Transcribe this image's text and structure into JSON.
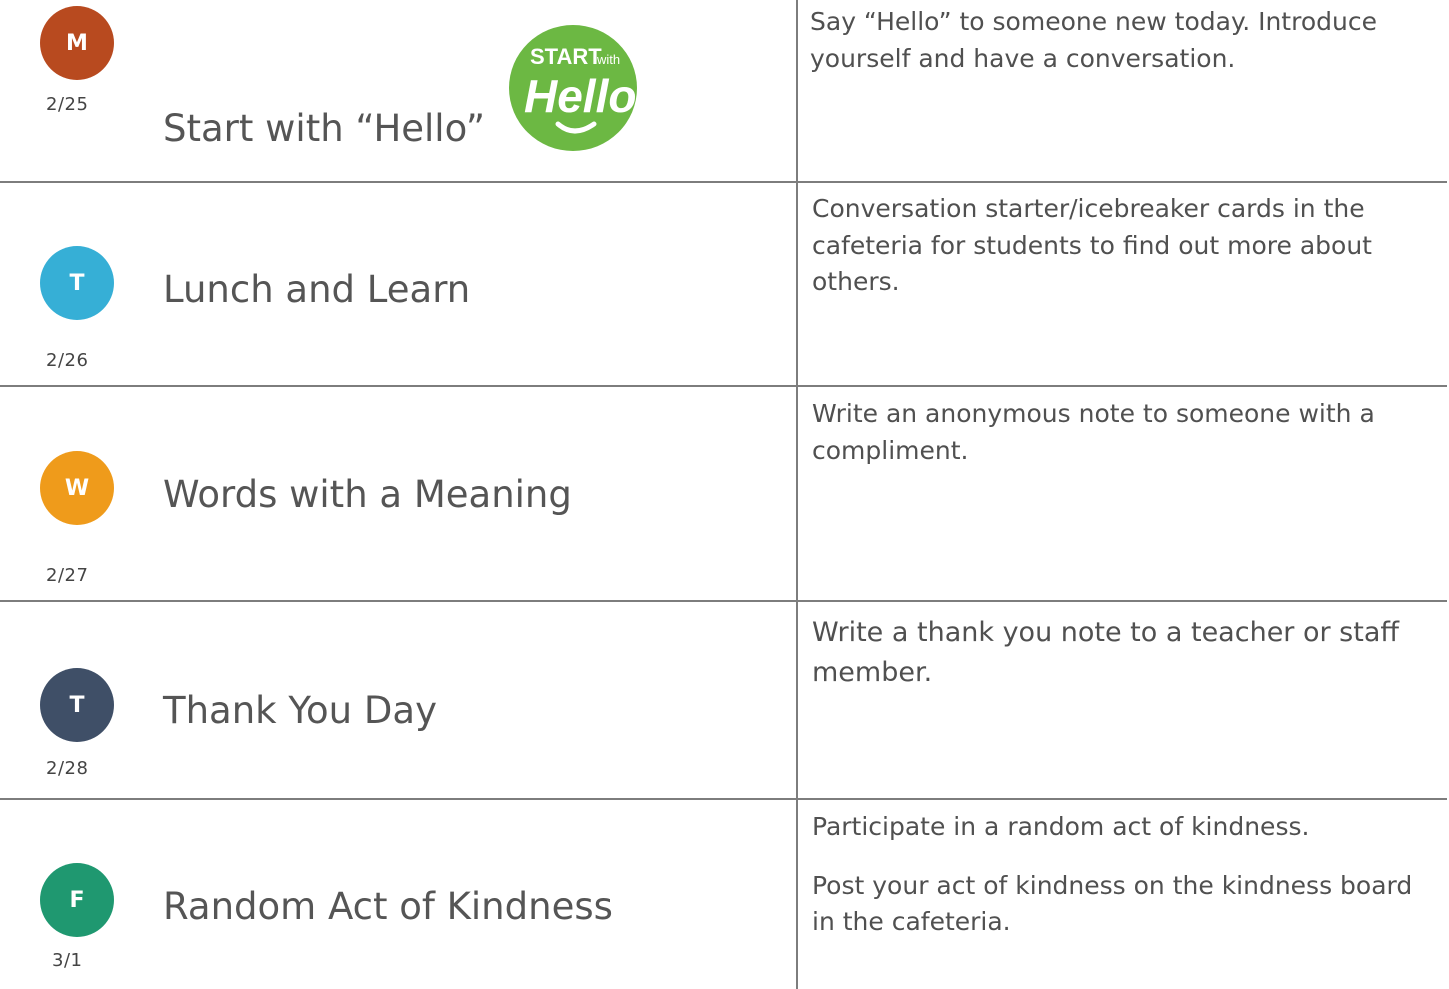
{
  "rows": [
    {
      "initial": "M",
      "color": "#b84a1f",
      "date": "2/25",
      "title": "Start with “Hello”",
      "description": [
        "Say “Hello” to someone new today.  Introduce yourself and have a conversation."
      ]
    },
    {
      "initial": "T",
      "color": "#36afd6",
      "date": "2/26",
      "title": "Lunch and Learn",
      "description": [
        "Conversation starter/icebreaker cards in the cafeteria for students to find out more about others."
      ]
    },
    {
      "initial": "W",
      "color": "#ef9b1b",
      "date": "2/27",
      "title": "Words with a Meaning",
      "description": [
        "Write an anonymous note to someone with a compliment."
      ]
    },
    {
      "initial": "T",
      "color": "#3f4f67",
      "date": "2/28",
      "title": "Thank You Day",
      "description": [
        "Write a thank you note to a teacher or staff member."
      ]
    },
    {
      "initial": "F",
      "color": "#1f9870",
      "date": "3/1",
      "title": "Random Act of Kindness",
      "description": [
        "Participate in a random act of kindness.",
        "Post your act of kindness on the kindness board in the cafeteria."
      ]
    }
  ],
  "logo": {
    "line1": "START",
    "line2": "with",
    "line3": "Hello",
    "color": "#6cb843"
  }
}
